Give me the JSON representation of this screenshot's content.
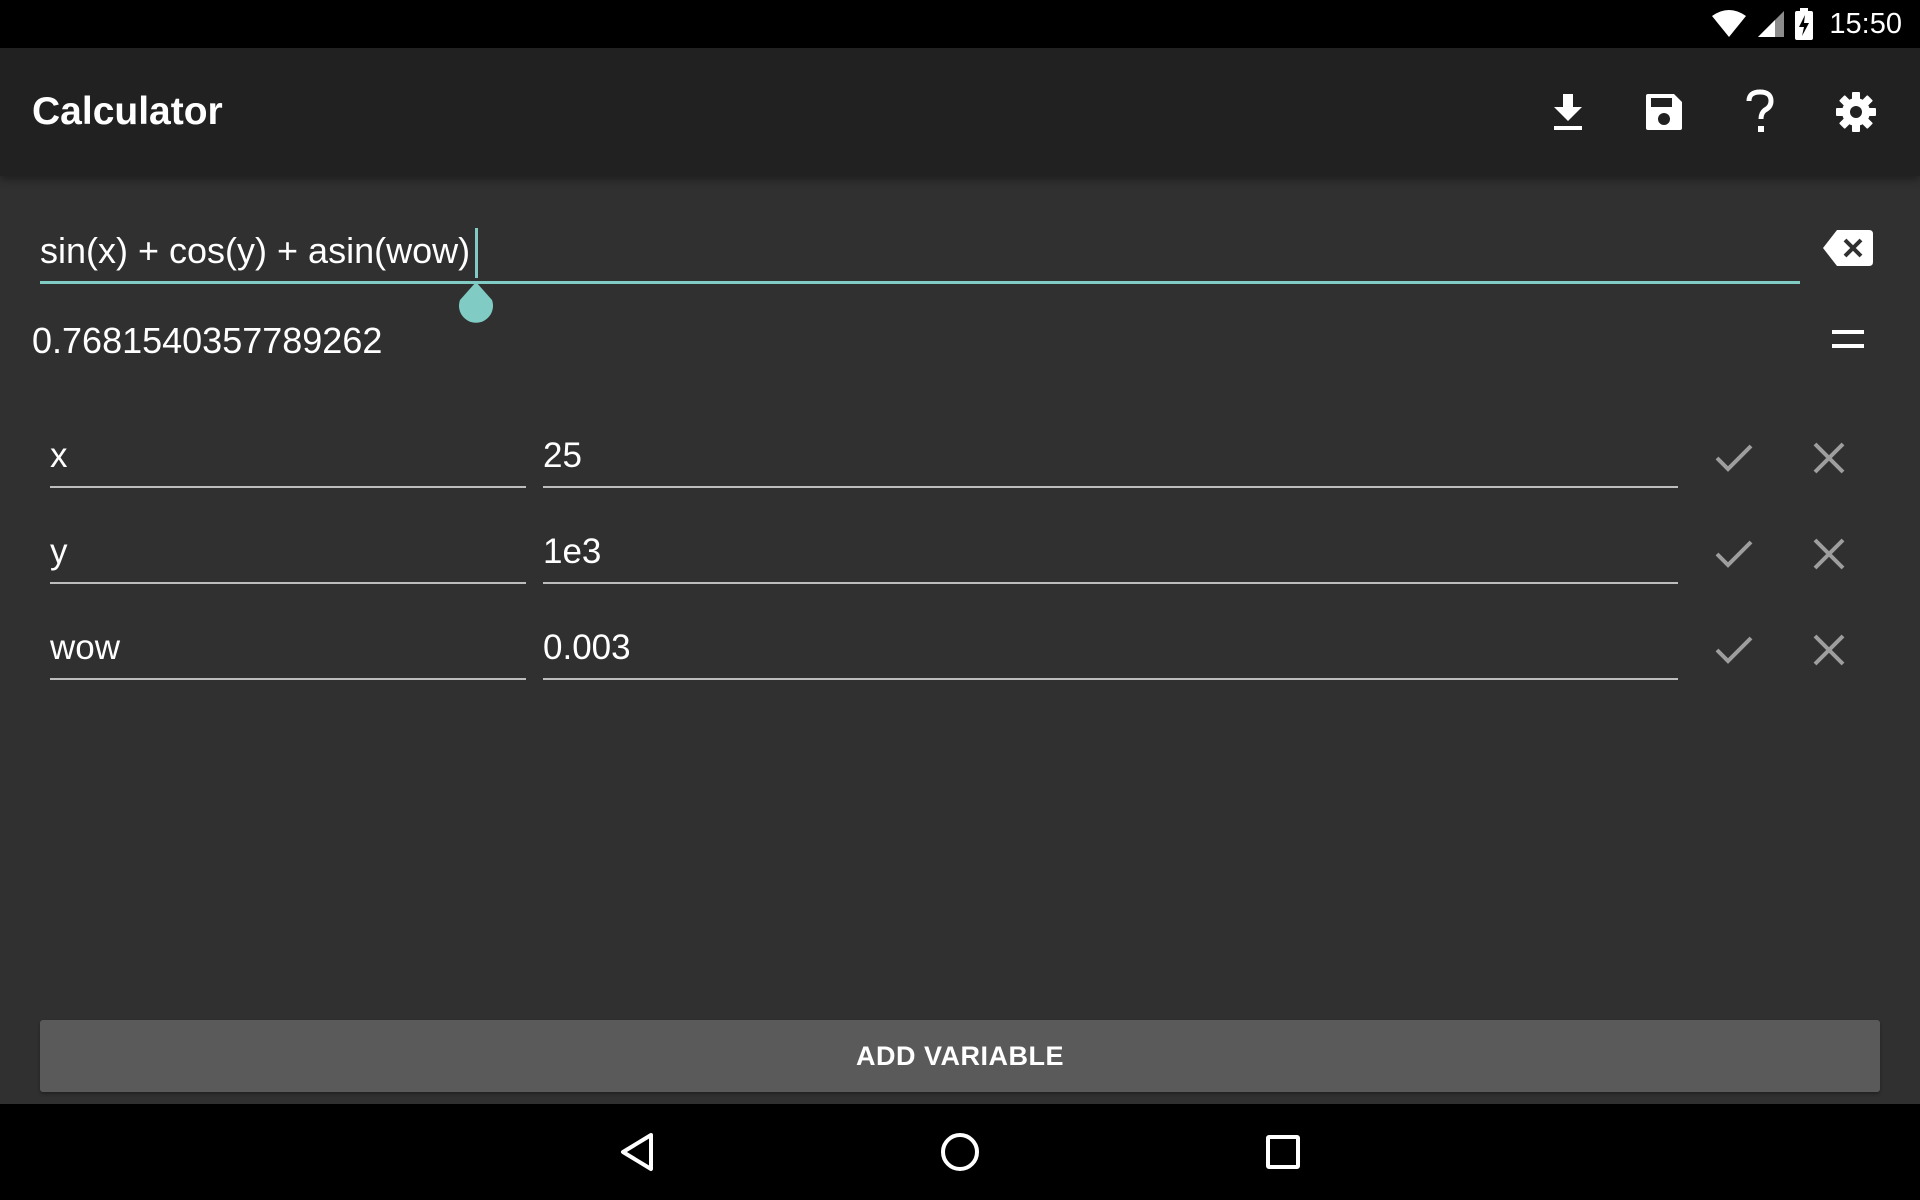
{
  "status_bar": {
    "time": "15:50",
    "icons": [
      "wifi-icon",
      "cell-signal-icon",
      "battery-charging-icon"
    ]
  },
  "app_bar": {
    "title": "Calculator",
    "actions": [
      "download-icon",
      "save-icon",
      "help-icon",
      "settings-icon"
    ]
  },
  "expression": {
    "value": "sin(x) + cos(y) + asin(wow)",
    "clear_icon": "backspace-icon"
  },
  "result": {
    "value": "0.7681540357789262",
    "equals_icon": "equals-icon"
  },
  "variables": [
    {
      "name": "x",
      "value": "25"
    },
    {
      "name": "y",
      "value": "1e3"
    },
    {
      "name": "wow",
      "value": "0.003"
    }
  ],
  "add_variable_label": "ADD VARIABLE",
  "nav_bar": {
    "buttons": [
      "back-icon",
      "home-icon",
      "recents-icon"
    ]
  },
  "colors": {
    "accent": "#80cbc4",
    "background": "#303030",
    "app_bar": "#212121",
    "button": "#5a5a5a",
    "muted_icon": "#9e9e9e"
  }
}
